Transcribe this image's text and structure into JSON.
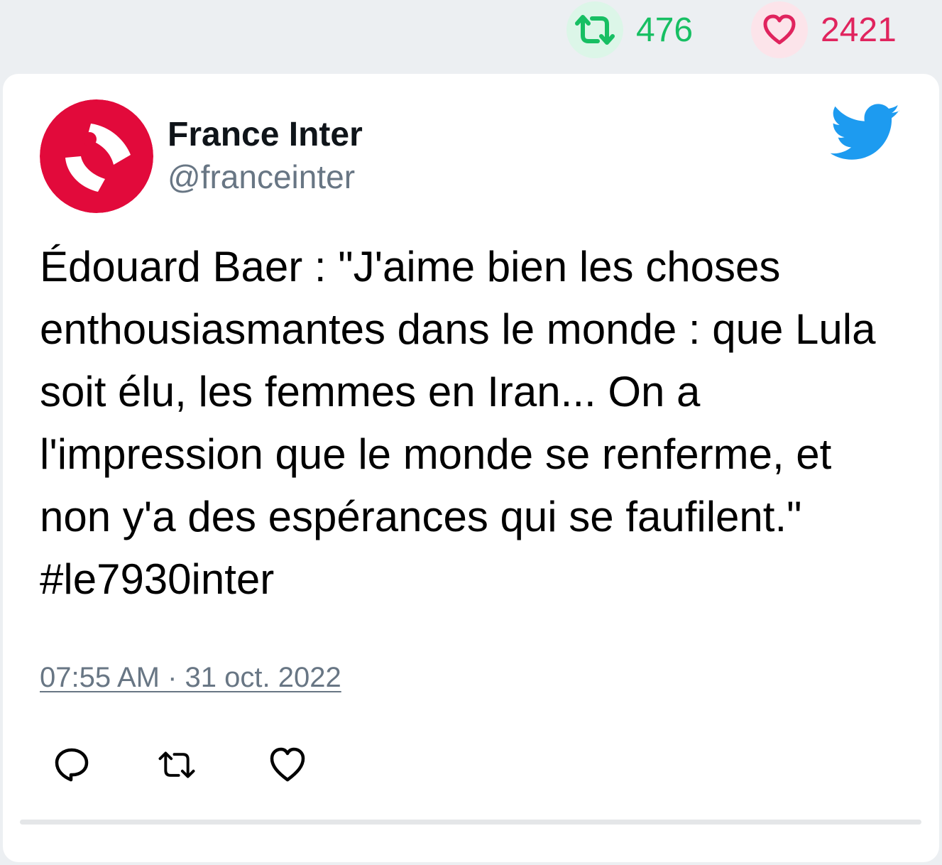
{
  "stats": {
    "retweets": "476",
    "likes": "2421",
    "retweet_color": "#17bf63",
    "like_color": "#e0245e"
  },
  "tweet": {
    "author_name": "France Inter",
    "author_handle": "@franceinter",
    "text": "Édouard Baer : \"J'aime bien les choses enthousiasmantes dans le monde : que Lula soit élu, les femmes en Iran... On a l'impression que le monde se renferme, et non y'a des espérances qui se faufilent.\" #le7930inter",
    "timestamp": "07:55 AM · 31 oct. 2022",
    "avatar_color": "#e20a3b",
    "brand_color": "#1d9bf0"
  },
  "actions": {
    "reply_icon": "reply-icon",
    "retweet_icon": "retweet-icon",
    "like_icon": "heart-icon"
  }
}
